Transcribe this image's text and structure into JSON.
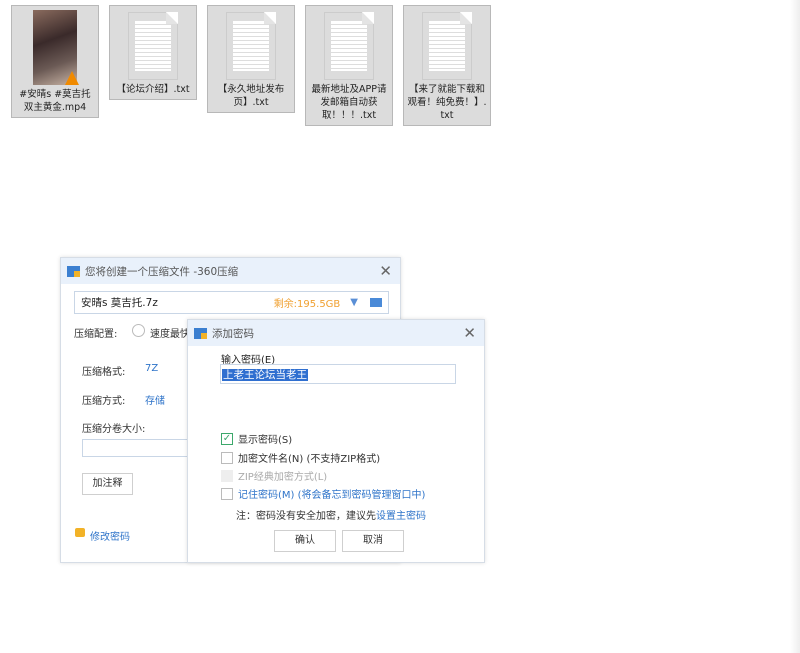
{
  "files": [
    {
      "name": "#安晴s #莫吉托双主黄金.mp4",
      "type": "video"
    },
    {
      "name": "【论坛介绍】.txt",
      "type": "text"
    },
    {
      "name": "【永久地址发布页】.txt",
      "type": "text"
    },
    {
      "name": "最新地址及APP请发邮箱自动获取！！！.txt",
      "type": "text"
    },
    {
      "name": "【来了就能下载和观看！纯免费！】.txt",
      "type": "text"
    }
  ],
  "main_dialog": {
    "title": "您将创建一个压缩文件 -360压缩",
    "filename": "安晴s 莫吉托.7z",
    "free_space": "剩余:195.5GB",
    "config_label": "压缩配置:",
    "config_option": "速度最快",
    "format_label": "压缩格式:",
    "format_value": "7Z",
    "method_label": "压缩方式:",
    "method_value": "存储",
    "split_label": "压缩分卷大小:",
    "split_value": "",
    "comment_button": "加注释",
    "change_password": "修改密码"
  },
  "password_dialog": {
    "title": "添加密码",
    "input_label": "输入密码(E)",
    "password_value": "上老王论坛当老王",
    "show_password": {
      "label": "显示密码(S)",
      "checked": true
    },
    "encrypt_names": {
      "label": "加密文件名(N) (不支持ZIP格式)",
      "checked": false
    },
    "zip_classic": {
      "label": "ZIP经典加密方式(L)",
      "checked": false,
      "disabled": true
    },
    "remember": {
      "label": "记住密码(M) (将会备忘到密码管理窗口中)",
      "checked": false
    },
    "note": "注：密码没有安全加密，建议先",
    "note_link": "设置主密码",
    "ok": "确认",
    "cancel": "取消"
  },
  "colors": {
    "accent": "#2f74c9",
    "free_space": "#f0a030",
    "titlebar": "#e9f1fb",
    "selection": "#2f6fd0"
  }
}
